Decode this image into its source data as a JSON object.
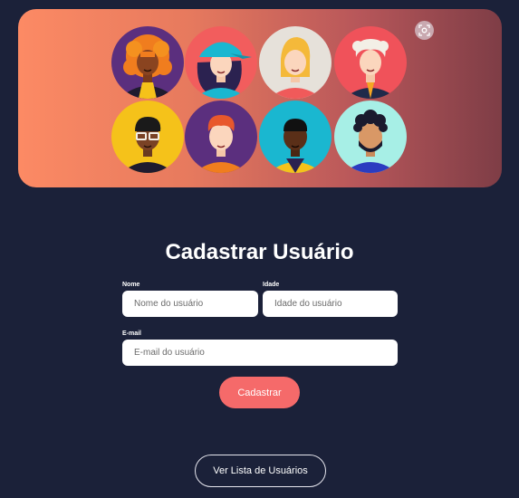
{
  "hero": {
    "avatars": [
      {
        "name": "avatar-woman-curly-orange-hair",
        "bg": "#5b2f7e"
      },
      {
        "name": "avatar-woman-cap",
        "bg": "#f25d5d"
      },
      {
        "name": "avatar-woman-blonde",
        "bg": "#e6e1da"
      },
      {
        "name": "avatar-man-white-hair",
        "bg": "#f0525a"
      },
      {
        "name": "avatar-man-glasses",
        "bg": "#f5c21a"
      },
      {
        "name": "avatar-man-red-hair",
        "bg": "#5b2f7e"
      },
      {
        "name": "avatar-man-dark-skin",
        "bg": "#1ab7d0"
      },
      {
        "name": "avatar-man-beard",
        "bg": "#a7efe6"
      }
    ]
  },
  "form": {
    "title": "Cadastrar Usuário",
    "nome_label": "Nome",
    "nome_placeholder": "Nome do usuário",
    "idade_label": "Idade",
    "idade_placeholder": "Idade do usuário",
    "email_label": "E-mail",
    "email_placeholder": "E-mail do usuário",
    "submit_label": "Cadastrar"
  },
  "footer": {
    "list_button_label": "Ver Lista de Usuários"
  },
  "colors": {
    "background": "#1b2139",
    "primary_button": "#f56a6a",
    "hero_gradient_start": "#fc8a64",
    "hero_gradient_end": "#7e3d46"
  }
}
